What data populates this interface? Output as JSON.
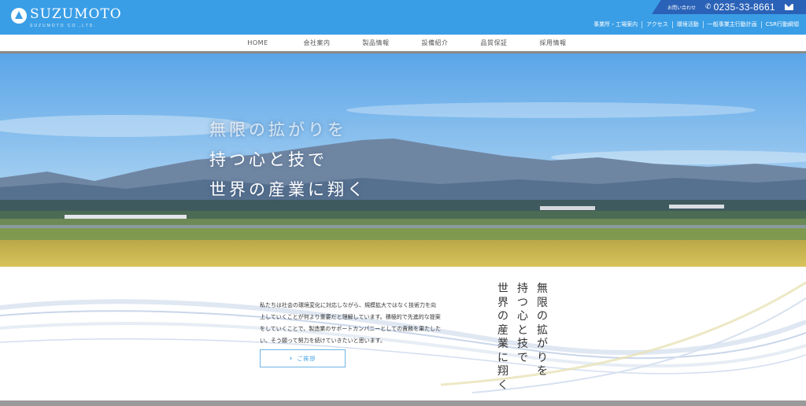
{
  "header": {
    "logo_name": "SUZUMOTO",
    "logo_sub": "SUZUMOTO CO.,LTD.",
    "contact_label": "お問い合わせ",
    "phone": "0235-33-8661",
    "icons": [
      "logo-mark-icon",
      "phone-icon",
      "mail-icon"
    ],
    "utility_links": [
      "事業所・工場案内",
      "アクセス",
      "環境活動",
      "一般事業主行動計画",
      "CSR行動綱領"
    ],
    "colors": {
      "bar": "#3a9ee6",
      "contact_box": "#2a62b7"
    }
  },
  "nav": {
    "items": [
      "HOME",
      "会社案内",
      "製品情報",
      "設備紹介",
      "品質保証",
      "採用情報"
    ]
  },
  "hero": {
    "lines": [
      "無限の拡がりを",
      "持つ心と技で",
      "世界の産業に翔く"
    ]
  },
  "intro": {
    "lines": [
      "私たちは社会の環境変化に対応しながら、規模拡大ではなく技術力を向",
      "上していくことが何より重要だと理解しています。積極的で先進的な提案",
      "をしていくことで、製造業のサポートカンパニーとしての責務を果たした",
      "い、そう願って努力を続けていきたいと思います。"
    ],
    "button_label": "ご挨拶",
    "button_icon": "chevron-right-icon"
  },
  "vertical_slogan": {
    "columns": [
      "無限の拡がりを",
      "持つ心と技で",
      "世界の産業に翔く"
    ]
  }
}
